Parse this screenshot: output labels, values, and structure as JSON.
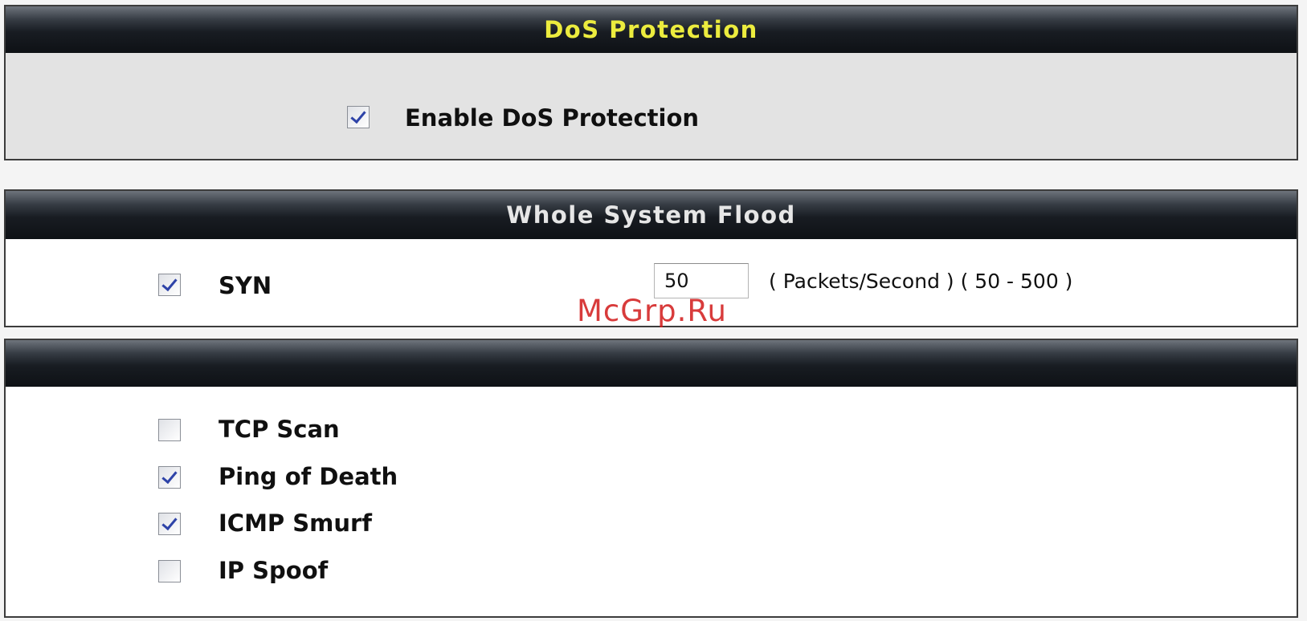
{
  "dos_protection": {
    "title": "DoS Protection",
    "enable_label": "Enable DoS Protection",
    "enable_checked": true
  },
  "whole_system_flood": {
    "title": "Whole System Flood",
    "syn_label": "SYN",
    "syn_checked": true,
    "syn_value": "50",
    "syn_unit": "( Packets/Second ) ( 50 - 500 )"
  },
  "attacks": {
    "title": "",
    "items": [
      {
        "label": "TCP Scan",
        "checked": false
      },
      {
        "label": "Ping of Death",
        "checked": true
      },
      {
        "label": "ICMP Smurf",
        "checked": true
      },
      {
        "label": "IP Spoof",
        "checked": false
      }
    ]
  },
  "watermark": "McGrp.Ru",
  "colors": {
    "header_gradient_top": "#6e747c",
    "header_gradient_bottom": "#0e1115",
    "title_yellow": "#ecec3e",
    "checkmark_blue": "#2e43a8",
    "watermark_red": "#d21a1a"
  }
}
